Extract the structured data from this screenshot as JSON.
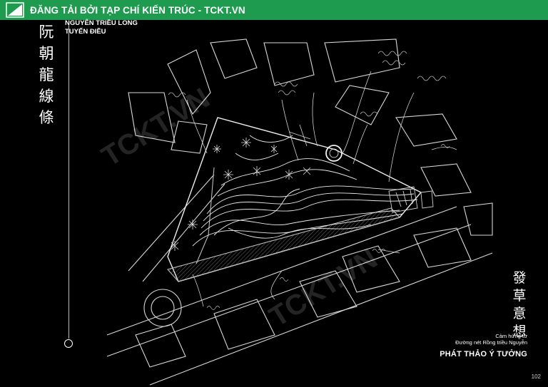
{
  "banner": {
    "text": "ĐĂNG TẢI BỞI TẠP CHÍ KIẾN TRÚC - TCKT.VN",
    "color": "#1e9b4f"
  },
  "left_title_chars": [
    "阮",
    "朝",
    "龍",
    "線",
    "條"
  ],
  "author": {
    "line1": "NGUYỄN TRIỀU LONG",
    "line2": "TUYẾN ĐIỀU"
  },
  "right_title_chars": [
    "發",
    "草",
    "意",
    "想"
  ],
  "caption": {
    "line1": "Cảm hứng từ",
    "line2": "Đường nét Rồng triều Nguyễn",
    "title": "PHÁT THẢO Ý TƯỞNG"
  },
  "watermark": "TCKT.VN",
  "page_number": "102"
}
